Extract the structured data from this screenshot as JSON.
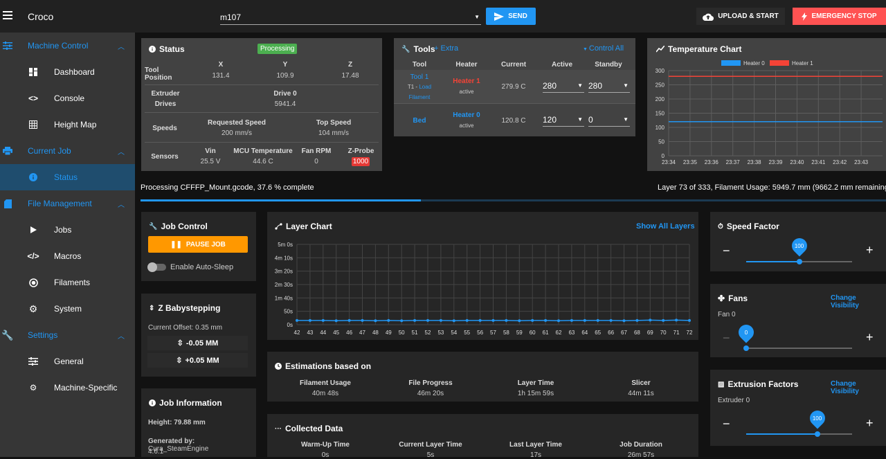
{
  "app": {
    "title": "Croco",
    "gcode_input": "m107",
    "send_label": "SEND",
    "upload_label": "UPLOAD & START",
    "estop_label": "EMERGENCY STOP"
  },
  "sidebar": {
    "groups": [
      {
        "label": "Machine Control"
      },
      {
        "label": "Current Job"
      },
      {
        "label": "File Management"
      },
      {
        "label": "Settings"
      }
    ],
    "items": [
      {
        "label": "Dashboard"
      },
      {
        "label": "Console"
      },
      {
        "label": "Height Map"
      },
      {
        "label": "Status"
      },
      {
        "label": "Jobs"
      },
      {
        "label": "Macros"
      },
      {
        "label": "Filaments"
      },
      {
        "label": "System"
      },
      {
        "label": "General"
      },
      {
        "label": "Machine-Specific"
      }
    ]
  },
  "status": {
    "title": "Status",
    "badge": "Processing",
    "tool_position_label": "Tool Position",
    "x_label": "X",
    "y_label": "Y",
    "z_label": "Z",
    "x": "131.4",
    "y": "109.9",
    "z": "17.48",
    "extruder_label_1": "Extruder",
    "extruder_label_2": "Drives",
    "drive_label": "Drive 0",
    "drive_value": "5941.4",
    "speeds_label": "Speeds",
    "req_speed_label": "Requested Speed",
    "req_speed": "200 mm/s",
    "top_speed_label": "Top Speed",
    "top_speed": "104 mm/s",
    "sensors_label": "Sensors",
    "vin_label": "Vin",
    "vin": "25.5 V",
    "mcu_label": "MCU Temperature",
    "mcu": "44.6 C",
    "fan_label": "Fan RPM",
    "fan": "0",
    "zprobe_label": "Z-Probe",
    "zprobe": "1000"
  },
  "tools": {
    "title": "Tools",
    "extra": "Extra",
    "control_all": "Control All",
    "headers": {
      "tool": "Tool",
      "heater": "Heater",
      "current": "Current",
      "active": "Active",
      "standby": "Standby"
    },
    "tool1": {
      "name": "Tool 1",
      "t1": "T1 -",
      "load": "Load",
      "filament": "Filament",
      "heater": "Heater 1",
      "state": "active",
      "current": "279.9 C",
      "active": "280",
      "standby": "280"
    },
    "bed": {
      "name": "Bed",
      "heater": "Heater 0",
      "state": "active",
      "current": "120.8 C",
      "active": "120",
      "standby": "0"
    }
  },
  "temp_chart": {
    "title": "Temperature Chart"
  },
  "progress": {
    "text": "Processing CFFFP_Mount.gcode, 37.6 % complete",
    "layer_text": "Layer 73 of 333, Filament Usage: 5949.7 mm (9662.2 mm remaining)",
    "fraction": 0.376
  },
  "job_control": {
    "title": "Job Control",
    "pause_label": "PAUSE JOB",
    "autosleep_label": "Enable Auto-Sleep"
  },
  "babystep": {
    "title": "Z Babystepping",
    "offset": "Current Offset: 0.35 mm",
    "minus": "-0.05 MM",
    "plus": "+0.05 MM"
  },
  "job_info": {
    "title": "Job Information",
    "height": "Height: 79.88 mm",
    "generated_label": "Generated by:",
    "generated_value": "Cura_SteamEngine",
    "version": "4.6.1"
  },
  "layer_chart": {
    "title": "Layer Chart",
    "show_all": "Show All Layers"
  },
  "estimations": {
    "title": "Estimations based on",
    "items": [
      {
        "label": "Filament Usage",
        "value": "40m 48s"
      },
      {
        "label": "File Progress",
        "value": "46m 20s"
      },
      {
        "label": "Layer Time",
        "value": "1h 15m 59s"
      },
      {
        "label": "Slicer",
        "value": "44m 11s"
      }
    ]
  },
  "collected": {
    "title": "Collected Data",
    "items": [
      {
        "label": "Warm-Up Time",
        "value": "0s"
      },
      {
        "label": "Current Layer Time",
        "value": "5s"
      },
      {
        "label": "Last Layer Time",
        "value": "17s"
      },
      {
        "label": "Job Duration",
        "value": "26m 57s"
      }
    ]
  },
  "speed_factor": {
    "title": "Speed Factor",
    "value": "100",
    "level": 0.5
  },
  "fans": {
    "title": "Fans",
    "change": "Change Visibility",
    "fan_label": "Fan 0",
    "value": "0",
    "level": 0.0
  },
  "extrusion": {
    "title": "Extrusion Factors",
    "change": "Change Visibility",
    "label": "Extruder 0",
    "value": "100",
    "level": 0.67
  },
  "chart_data": [
    {
      "type": "line",
      "title": "Temperature Chart",
      "ylim": [
        0,
        300
      ],
      "yticks": [
        "0",
        "50",
        "100",
        "150",
        "200",
        "250",
        "300"
      ],
      "categories": [
        "23:34",
        "23:35",
        "23:36",
        "23:37",
        "23:38",
        "23:39",
        "23:40",
        "23:41",
        "23:42",
        "23:43"
      ],
      "series": [
        {
          "name": "Heater 0",
          "color": "#2196f3",
          "values": [
            120,
            120,
            120,
            120,
            120,
            120,
            120,
            120,
            120,
            120
          ]
        },
        {
          "name": "Heater 1",
          "color": "#f44336",
          "values": [
            280,
            280,
            280,
            280,
            280,
            280,
            280,
            280,
            280,
            280
          ]
        }
      ]
    },
    {
      "type": "line",
      "title": "Layer Chart",
      "ylabels": [
        "0s",
        "50s",
        "1m 40s",
        "2m 30s",
        "3m 20s",
        "4m 10s",
        "5m 0s"
      ],
      "ylim": [
        0,
        300
      ],
      "categories": [
        "42",
        "43",
        "44",
        "45",
        "46",
        "47",
        "48",
        "49",
        "50",
        "51",
        "52",
        "53",
        "54",
        "55",
        "56",
        "57",
        "58",
        "59",
        "60",
        "61",
        "62",
        "63",
        "64",
        "65",
        "66",
        "67",
        "68",
        "69",
        "70",
        "71",
        "72"
      ],
      "series": [
        {
          "name": "",
          "color": "#2196f3",
          "values": [
            16,
            16,
            16,
            15,
            16,
            16,
            15,
            16,
            15,
            16,
            16,
            16,
            15,
            16,
            16,
            16,
            16,
            15,
            16,
            16,
            15,
            16,
            16,
            16,
            16,
            15,
            16,
            17,
            16,
            17,
            16
          ]
        }
      ]
    }
  ]
}
